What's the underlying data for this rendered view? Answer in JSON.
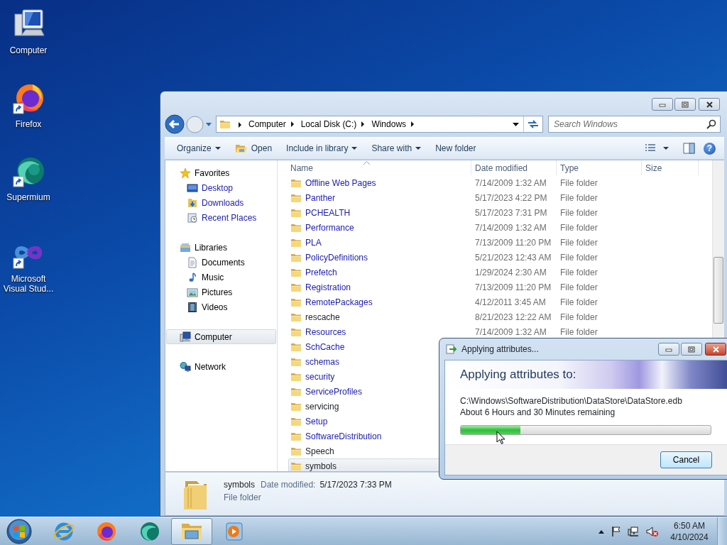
{
  "desktop_icons": [
    {
      "label": "Computer",
      "kind": "computer",
      "shortcut": false
    },
    {
      "label": "Firefox",
      "kind": "firefox",
      "shortcut": true
    },
    {
      "label": "Supermium",
      "kind": "supermium",
      "shortcut": true
    },
    {
      "label": "Microsoft Visual Stud...",
      "kind": "vs",
      "shortcut": true
    }
  ],
  "explorer": {
    "breadcrumb": [
      "Computer",
      "Local Disk (C:)",
      "Windows"
    ],
    "search": {
      "placeholder": "Search Windows"
    },
    "toolbar": [
      {
        "label": "Organize",
        "kind": "menu"
      },
      {
        "label": "Open",
        "kind": "open"
      },
      {
        "label": "Include in library",
        "kind": "menu"
      },
      {
        "label": "Share with",
        "kind": "menu"
      },
      {
        "label": "New folder",
        "kind": "plain"
      }
    ],
    "help_label": "?",
    "nav": [
      {
        "label": "Favorites",
        "kind": "favorites",
        "selected": false,
        "compressed": false,
        "children": [
          {
            "label": "Desktop",
            "kind": "desktop",
            "selected": false,
            "compressed": true
          },
          {
            "label": "Downloads",
            "kind": "downloads",
            "selected": false,
            "compressed": true
          },
          {
            "label": "Recent Places",
            "kind": "recent",
            "selected": false,
            "compressed": true
          }
        ]
      },
      {
        "label": "Libraries",
        "kind": "libraries",
        "selected": false,
        "compressed": false,
        "children": [
          {
            "label": "Documents",
            "kind": "documents",
            "selected": false,
            "compressed": false
          },
          {
            "label": "Music",
            "kind": "music",
            "selected": false,
            "compressed": false
          },
          {
            "label": "Pictures",
            "kind": "pictures",
            "selected": false,
            "compressed": false
          },
          {
            "label": "Videos",
            "kind": "videos",
            "selected": false,
            "compressed": false
          }
        ]
      },
      {
        "label": "Computer",
        "kind": "computer",
        "selected": true,
        "compressed": false
      },
      {
        "label": "Network",
        "kind": "network",
        "selected": false,
        "compressed": false
      }
    ],
    "columns": [
      "Name",
      "Date modified",
      "Type",
      "Size"
    ],
    "rows": [
      {
        "name": "Offline Web Pages",
        "date": "7/14/2009 1:32 AM",
        "type": "File folder",
        "compressed": true,
        "selected": false
      },
      {
        "name": "Panther",
        "date": "5/17/2023 4:22 PM",
        "type": "File folder",
        "compressed": true,
        "selected": false
      },
      {
        "name": "PCHEALTH",
        "date": "5/17/2023 7:31 PM",
        "type": "File folder",
        "compressed": true,
        "selected": false
      },
      {
        "name": "Performance",
        "date": "7/14/2009 1:32 AM",
        "type": "File folder",
        "compressed": true,
        "selected": false
      },
      {
        "name": "PLA",
        "date": "7/13/2009 11:20 PM",
        "type": "File folder",
        "compressed": true,
        "selected": false
      },
      {
        "name": "PolicyDefinitions",
        "date": "5/21/2023 12:43 AM",
        "type": "File folder",
        "compressed": true,
        "selected": false
      },
      {
        "name": "Prefetch",
        "date": "1/29/2024 2:30 AM",
        "type": "File folder",
        "compressed": true,
        "selected": false
      },
      {
        "name": "Registration",
        "date": "7/13/2009 11:20 PM",
        "type": "File folder",
        "compressed": true,
        "selected": false
      },
      {
        "name": "RemotePackages",
        "date": "4/12/2011 3:45 AM",
        "type": "File folder",
        "compressed": true,
        "selected": false
      },
      {
        "name": "rescache",
        "date": "8/21/2023 12:22 AM",
        "type": "File folder",
        "compressed": false,
        "selected": false
      },
      {
        "name": "Resources",
        "date": "7/14/2009 1:32 AM",
        "type": "File folder",
        "compressed": true,
        "selected": false
      },
      {
        "name": "SchCache",
        "compressed": true,
        "selected": false
      },
      {
        "name": "schemas",
        "compressed": true,
        "selected": false
      },
      {
        "name": "security",
        "compressed": true,
        "selected": false
      },
      {
        "name": "ServiceProfiles",
        "compressed": true,
        "selected": false
      },
      {
        "name": "servicing",
        "compressed": false,
        "selected": false
      },
      {
        "name": "Setup",
        "compressed": true,
        "selected": false
      },
      {
        "name": "SoftwareDistribution",
        "compressed": true,
        "selected": false
      },
      {
        "name": "Speech",
        "compressed": false,
        "selected": false
      },
      {
        "name": "symbols",
        "compressed": false,
        "selected": true
      }
    ],
    "details": {
      "name": "symbols",
      "date_label": "Date modified:",
      "date": "5/17/2023 7:33 PM",
      "type": "File folder"
    }
  },
  "dialog": {
    "title": "Applying attributes...",
    "heading": "Applying attributes to:",
    "path": "C:\\Windows\\SoftwareDistribution\\DataStore\\DataStore.edb",
    "remaining": "About 6 Hours and 30 Minutes remaining",
    "level": 0.24,
    "button": "Cancel"
  },
  "taskbar": {
    "apps": [
      {
        "kind": "ie",
        "active": false
      },
      {
        "kind": "firefox",
        "active": false
      },
      {
        "kind": "supermium",
        "active": false
      },
      {
        "kind": "explorer",
        "active": true
      },
      {
        "kind": "media",
        "active": false
      }
    ],
    "time": "6:50 AM",
    "date": "4/10/2024"
  }
}
